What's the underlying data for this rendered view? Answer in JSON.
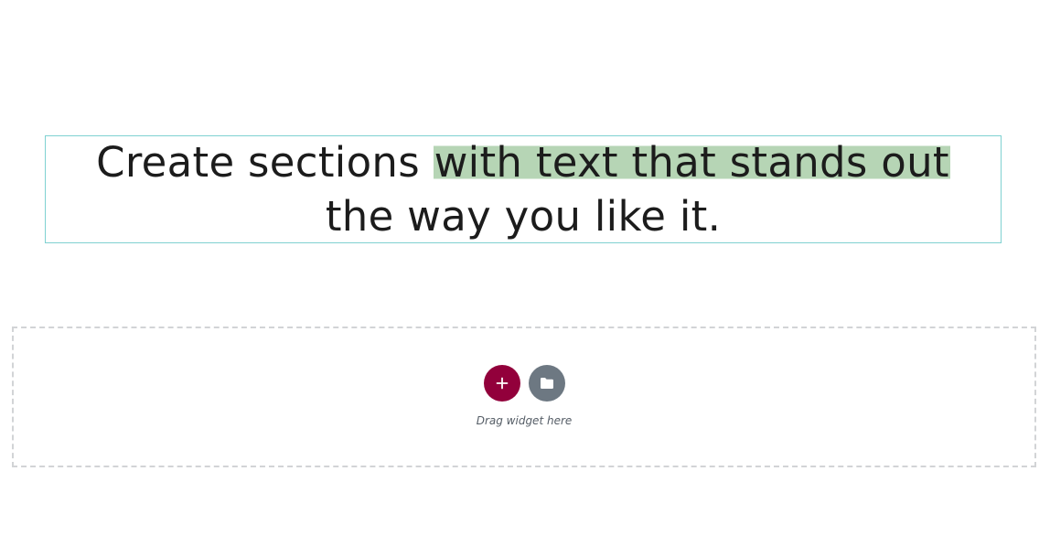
{
  "heading": {
    "text_before": "Create sections ",
    "text_highlight": "with text that stands out",
    "text_after": " the way you like it.",
    "highlight_color": "#b6d5b5",
    "border_color": "#7fd1d1"
  },
  "drop_zone": {
    "hint": "Drag widget here",
    "add_button": {
      "icon": "plus-icon",
      "color": "#92003b"
    },
    "template_button": {
      "icon": "folder-icon",
      "color": "#6d7882"
    }
  }
}
